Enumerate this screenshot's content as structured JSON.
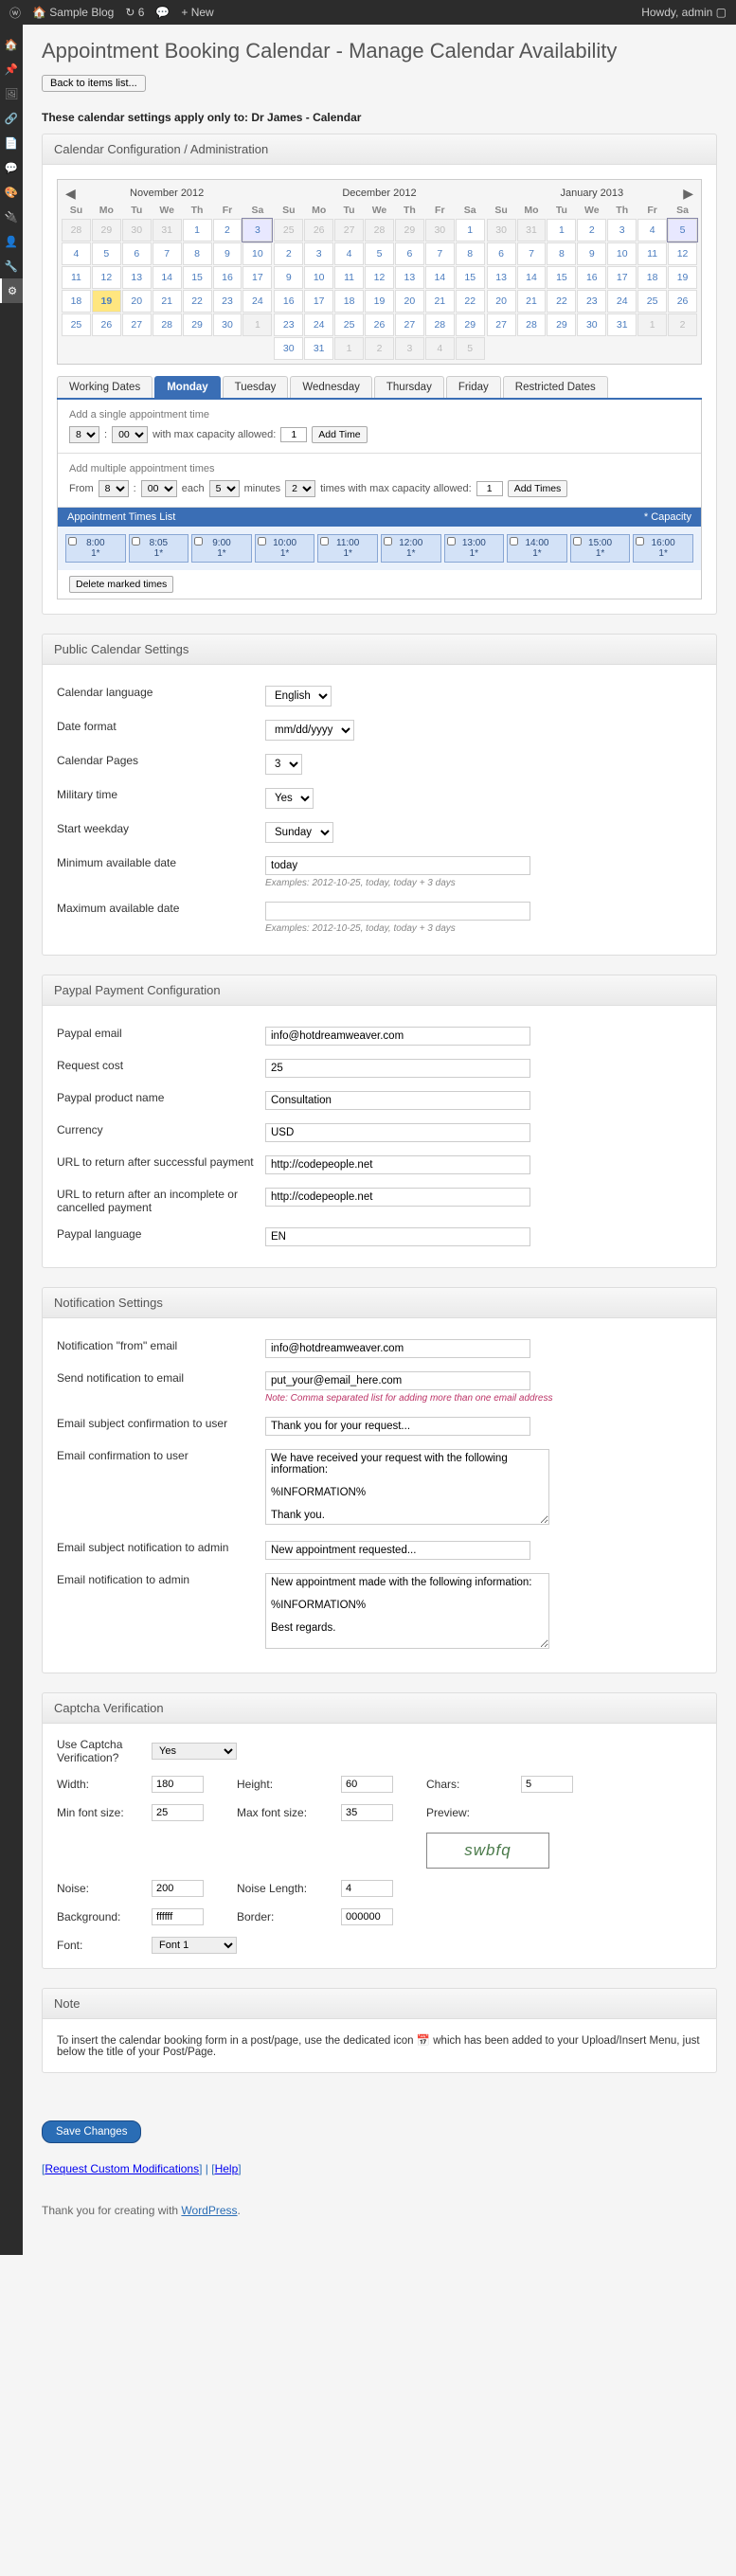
{
  "adminbar": {
    "site": "Sample Blog",
    "updates": "6",
    "new": "New",
    "howdy": "Howdy, admin"
  },
  "page": {
    "title": "Appointment Booking Calendar - Manage Calendar Availability",
    "back": "Back to items list...",
    "apply_to": "These calendar settings apply only to: Dr James - Calendar"
  },
  "sec_cal": {
    "header": "Calendar Configuration / Administration"
  },
  "calNov": {
    "title": "November 2012"
  },
  "calDec": {
    "title": "December 2012"
  },
  "calJan": {
    "title": "January 2013"
  },
  "dow": {
    "d0": "Su",
    "d1": "Mo",
    "d2": "Tu",
    "d3": "We",
    "d4": "Th",
    "d5": "Fr",
    "d6": "Sa"
  },
  "tabs": {
    "working": "Working Dates",
    "mon": "Monday",
    "tue": "Tuesday",
    "wed": "Wednesday",
    "thu": "Thursday",
    "fri": "Friday",
    "restricted": "Restricted Dates"
  },
  "single": {
    "title": "Add a single appointment time",
    "cap_label": "with max capacity allowed:",
    "cap": "1",
    "btn": "Add Time",
    "h": "8",
    "m": "00"
  },
  "multi": {
    "title": "Add multiple appointment times",
    "from": "From",
    "each": "each",
    "minutes": "minutes",
    "times_label": "times with max capacity allowed:",
    "h": "8",
    "m": "00",
    "step": "5",
    "count": "2",
    "cap": "1",
    "btn": "Add Times"
  },
  "times": {
    "header": "Appointment Times List",
    "cap": "* Capacity",
    "t0a": "8:00",
    "t0b": "1*",
    "t1a": "8:05",
    "t1b": "1*",
    "t2a": "9:00",
    "t2b": "1*",
    "t3a": "10:00",
    "t3b": "1*",
    "t4a": "11:00",
    "t4b": "1*",
    "t5a": "12:00",
    "t5b": "1*",
    "t6a": "13:00",
    "t6b": "1*",
    "t7a": "14:00",
    "t7b": "1*",
    "t8a": "15:00",
    "t8b": "1*",
    "t9a": "16:00",
    "t9b": "1*",
    "delete": "Delete marked times"
  },
  "pub": {
    "header": "Public Calendar Settings",
    "lang_l": "Calendar language",
    "lang_v": "English",
    "datefmt_l": "Date format",
    "datefmt_v": "mm/dd/yyyy",
    "pages_l": "Calendar Pages",
    "pages_v": "3",
    "military_l": "Military time",
    "military_v": "Yes",
    "startwk_l": "Start weekday",
    "startwk_v": "Sunday",
    "min_l": "Minimum available date",
    "min_v": "today",
    "max_l": "Maximum available date",
    "max_v": "",
    "hint": "Examples: 2012-10-25, today, today + 3 days"
  },
  "pp": {
    "header": "Paypal Payment Configuration",
    "email_l": "Paypal email",
    "email_v": "info@hotdreamweaver.com",
    "cost_l": "Request cost",
    "cost_v": "25",
    "prod_l": "Paypal product name",
    "prod_v": "Consultation",
    "curr_l": "Currency",
    "curr_v": "USD",
    "url_ok_l": "URL to return after successful payment",
    "url_ok_v": "http://codepeople.net",
    "url_bad_l": "URL to return after an incomplete or cancelled payment",
    "url_bad_v": "http://codepeople.net",
    "lang_l": "Paypal language",
    "lang_v": "EN"
  },
  "notif": {
    "header": "Notification Settings",
    "from_l": "Notification \"from\" email",
    "from_v": "info@hotdreamweaver.com",
    "to_l": "Send notification to email",
    "to_v": "put_your@email_here.com",
    "to_hint": "Note: Comma separated list for adding more than one email address",
    "usubj_l": "Email subject confirmation to user",
    "usubj_v": "Thank you for your request...",
    "ubody_l": "Email confirmation to user",
    "ubody_v": "We have received your request with the following information:\n\n%INFORMATION%\n\nThank you.",
    "asubj_l": "Email subject notification to admin",
    "asubj_v": "New appointment requested...",
    "abody_l": "Email notification to admin",
    "abody_v": "New appointment made with the following information:\n\n%INFORMATION%\n\nBest regards."
  },
  "captcha": {
    "header": "Captcha Verification",
    "use_l": "Use Captcha Verification?",
    "use_v": "Yes",
    "w_l": "Width:",
    "w_v": "180",
    "h_l": "Height:",
    "h_v": "60",
    "chars_l": "Chars:",
    "chars_v": "5",
    "minf_l": "Min font size:",
    "minf_v": "25",
    "maxf_l": "Max font size:",
    "maxf_v": "35",
    "preview_l": "Preview:",
    "preview_v": "swbfq",
    "noise_l": "Noise:",
    "noise_v": "200",
    "nlen_l": "Noise Length:",
    "nlen_v": "4",
    "bg_l": "Background:",
    "bg_v": "ffffff",
    "border_l": "Border:",
    "border_v": "000000",
    "font_l": "Font:",
    "font_v": "Font 1"
  },
  "note": {
    "header": "Note",
    "text": "To insert the calendar booking form in a post/page, use the dedicated icon  📅  which has been added to your Upload/Insert Menu, just below the title of your Post/Page."
  },
  "save": "Save Changes",
  "links": {
    "a": "Request Custom Modifications",
    "sep": " | ",
    "b": "Help"
  },
  "footer": {
    "t1": "Thank you for creating with ",
    "t2": "WordPress",
    "t3": "."
  }
}
